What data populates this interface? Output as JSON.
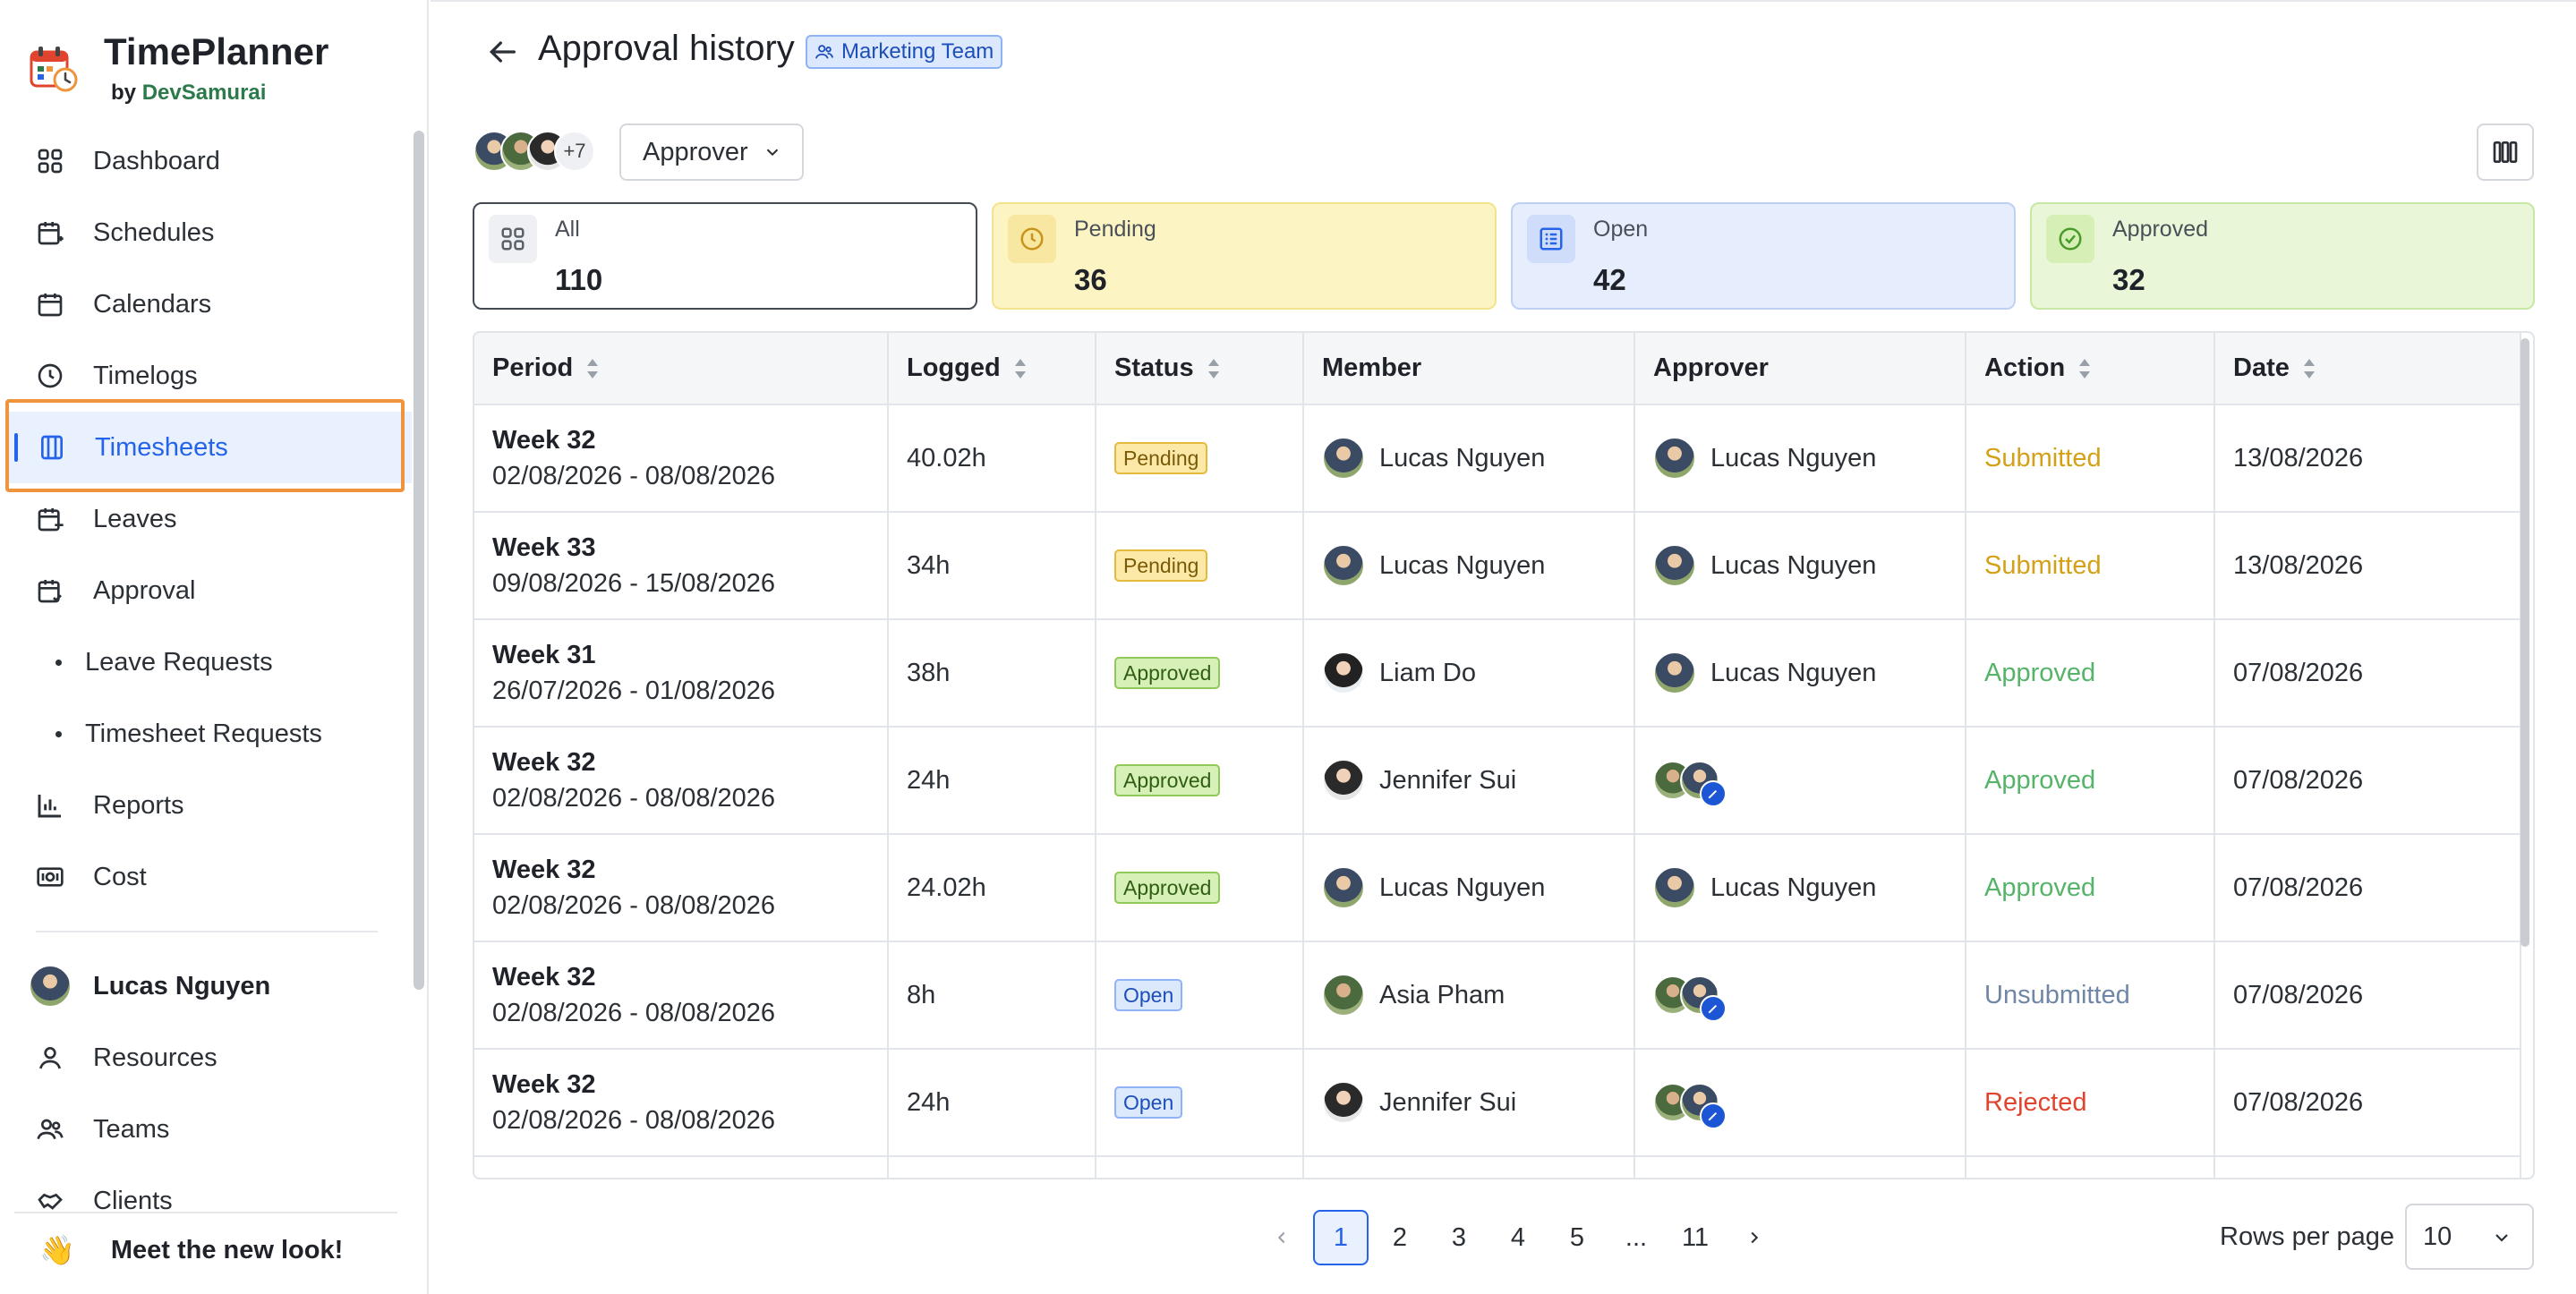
{
  "app": {
    "title": "TimePlanner",
    "by": "by",
    "by_brand": "DevSamurai"
  },
  "sidebar": {
    "items": [
      {
        "label": "Dashboard",
        "icon": "dashboard-icon"
      },
      {
        "label": "Schedules",
        "icon": "schedule-icon"
      },
      {
        "label": "Calendars",
        "icon": "calendar-icon"
      },
      {
        "label": "Timelogs",
        "icon": "clock-icon"
      },
      {
        "label": "Timesheets",
        "icon": "timesheet-icon",
        "active": true
      },
      {
        "label": "Leaves",
        "icon": "leave-icon"
      },
      {
        "label": "Approval",
        "icon": "approval-icon"
      },
      {
        "label": "Leave Requests",
        "sub": true
      },
      {
        "label": "Timesheet Requests",
        "sub": true
      },
      {
        "label": "Reports",
        "icon": "bar-chart-icon"
      },
      {
        "label": "Cost",
        "icon": "cost-icon"
      }
    ],
    "user": "Lucas Nguyen",
    "bottom_items": [
      {
        "label": "Resources",
        "icon": "person-icon"
      },
      {
        "label": "Teams",
        "icon": "team-icon"
      },
      {
        "label": "Clients",
        "icon": "handshake-icon"
      }
    ],
    "new_look": "Meet the new look!"
  },
  "header": {
    "title": "Approval history",
    "team_badge": "Marketing Team"
  },
  "toolbar": {
    "avatars_more": "+7",
    "approver_filter": "Approver"
  },
  "cards": [
    {
      "label": "All",
      "value": "110"
    },
    {
      "label": "Pending",
      "value": "36"
    },
    {
      "label": "Open",
      "value": "42"
    },
    {
      "label": "Approved",
      "value": "32"
    }
  ],
  "table": {
    "columns": [
      "Period",
      "Logged",
      "Status",
      "Member",
      "Approver",
      "Action",
      "Date"
    ],
    "rows": [
      {
        "week": "Week 32",
        "range": "02/08/2026 - 08/08/2026",
        "logged": "40.02h",
        "status": "Pending",
        "member": "Lucas Nguyen",
        "approver": "Lucas Nguyen",
        "action": "Submitted",
        "date": "13/08/2026"
      },
      {
        "week": "Week 33",
        "range": "09/08/2026 - 15/08/2026",
        "logged": "34h",
        "status": "Pending",
        "member": "Lucas Nguyen",
        "approver": "Lucas Nguyen",
        "action": "Submitted",
        "date": "13/08/2026"
      },
      {
        "week": "Week 31",
        "range": "26/07/2026 - 01/08/2026",
        "logged": "38h",
        "status": "Approved",
        "member": "Liam Do",
        "approver": "Lucas Nguyen",
        "action": "Approved",
        "date": "07/08/2026"
      },
      {
        "week": "Week 32",
        "range": "02/08/2026 - 08/08/2026",
        "logged": "24h",
        "status": "Approved",
        "member": "Jennifer Sui",
        "approver": "",
        "action": "Approved",
        "date": "07/08/2026"
      },
      {
        "week": "Week 32",
        "range": "02/08/2026 - 08/08/2026",
        "logged": "24.02h",
        "status": "Approved",
        "member": "Lucas Nguyen",
        "approver": "Lucas Nguyen",
        "action": "Approved",
        "date": "07/08/2026"
      },
      {
        "week": "Week 32",
        "range": "02/08/2026 - 08/08/2026",
        "logged": "8h",
        "status": "Open",
        "member": "Asia Pham",
        "approver": "",
        "action": "Unsubmitted",
        "date": "07/08/2026"
      },
      {
        "week": "Week 32",
        "range": "02/08/2026 - 08/08/2026",
        "logged": "24h",
        "status": "Open",
        "member": "Jennifer Sui",
        "approver": "",
        "action": "Rejected",
        "date": "07/08/2026"
      }
    ]
  },
  "pagination": {
    "pages": [
      "1",
      "2",
      "3",
      "4",
      "5",
      "...",
      "11"
    ],
    "current": "1",
    "rows_per_page_label": "Rows per page",
    "rows_per_page": "10"
  },
  "colors": {
    "accent": "#2563eb",
    "highlight": "#f0933d",
    "pending": "#d4a017",
    "approved": "#55b46a",
    "rejected": "#e0442f",
    "unsubmitted": "#6f86a6"
  }
}
